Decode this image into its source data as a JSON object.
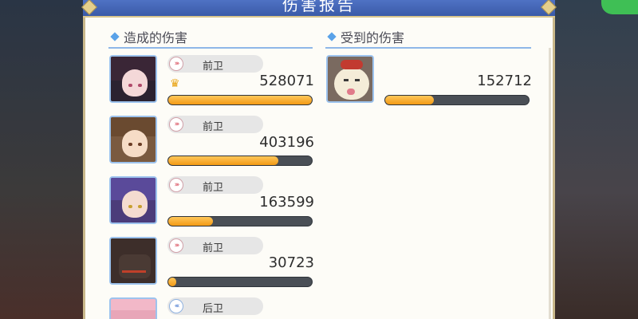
{
  "window": {
    "title": "伤害报告"
  },
  "dealt": {
    "header": "造成的伤害",
    "entries": [
      {
        "role": "前卫",
        "value": "528071",
        "fill": 1.0,
        "top": true,
        "avatar": "portrait-1"
      },
      {
        "role": "前卫",
        "value": "403196",
        "fill": 0.764
      },
      {
        "role": "前卫",
        "value": "163599",
        "fill": 0.31
      },
      {
        "role": "前卫",
        "value": "30723",
        "fill": 0.058
      },
      {
        "role": "后卫",
        "value": "",
        "fill": 0.0
      }
    ]
  },
  "taken": {
    "header": "受到的伤害",
    "entries": [
      {
        "value": "152712",
        "fill": 0.34
      }
    ]
  },
  "colors": {
    "accent": "#5aa2e8",
    "bar_fill": "#f29a14",
    "bar_track": "#4a4f56",
    "crown": "#e8a210"
  },
  "icons": {
    "top_damage": "crown-icon",
    "role": "role-chevron-icon"
  }
}
